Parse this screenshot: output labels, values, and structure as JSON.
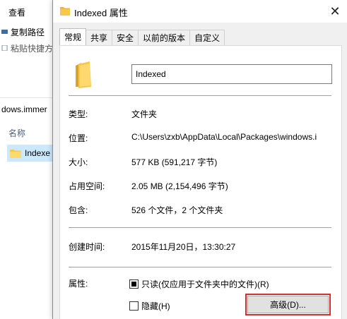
{
  "explorer": {
    "view_menu": "查看",
    "copy_path": "复制路径",
    "paste_shortcut": "粘贴快捷方",
    "address_fragment": "dows.immer",
    "column_name": "名称",
    "item_name": "Indexe"
  },
  "dialog": {
    "title": "Indexed 属性",
    "close_glyph": "✕",
    "tabs": [
      {
        "label": "常规",
        "active": true
      },
      {
        "label": "共享",
        "active": false
      },
      {
        "label": "安全",
        "active": false
      },
      {
        "label": "以前的版本",
        "active": false
      },
      {
        "label": "自定义",
        "active": false
      }
    ],
    "folder_name": "Indexed",
    "fields": {
      "type": {
        "label": "类型:",
        "value": "文件夹"
      },
      "location": {
        "label": "位置:",
        "value": "C:\\Users\\zxb\\AppData\\Local\\Packages\\windows.i"
      },
      "size": {
        "label": "大小:",
        "value": "577 KB (591,217 字节)"
      },
      "size_on_disk": {
        "label": "占用空间:",
        "value": "2.05 MB (2,154,496 字节)"
      },
      "contains": {
        "label": "包含:",
        "value": "526 个文件，2 个文件夹"
      },
      "created": {
        "label": "创建时间:",
        "value": "2015年11月20日，13:30:27"
      },
      "attributes": {
        "label": "属性:"
      }
    },
    "readonly": {
      "label": "只读(仅应用于文件夹中的文件)(R)",
      "checked": true
    },
    "hidden": {
      "label": "隐藏(H)",
      "checked": false
    },
    "advanced_button": "高级(D)..."
  },
  "icons": {
    "folder": "folder-icon",
    "close": "close-icon"
  },
  "colors": {
    "folder_yellow": "#f6c94e",
    "selection": "#cce8ff",
    "highlight_red": "#d32f2f"
  }
}
